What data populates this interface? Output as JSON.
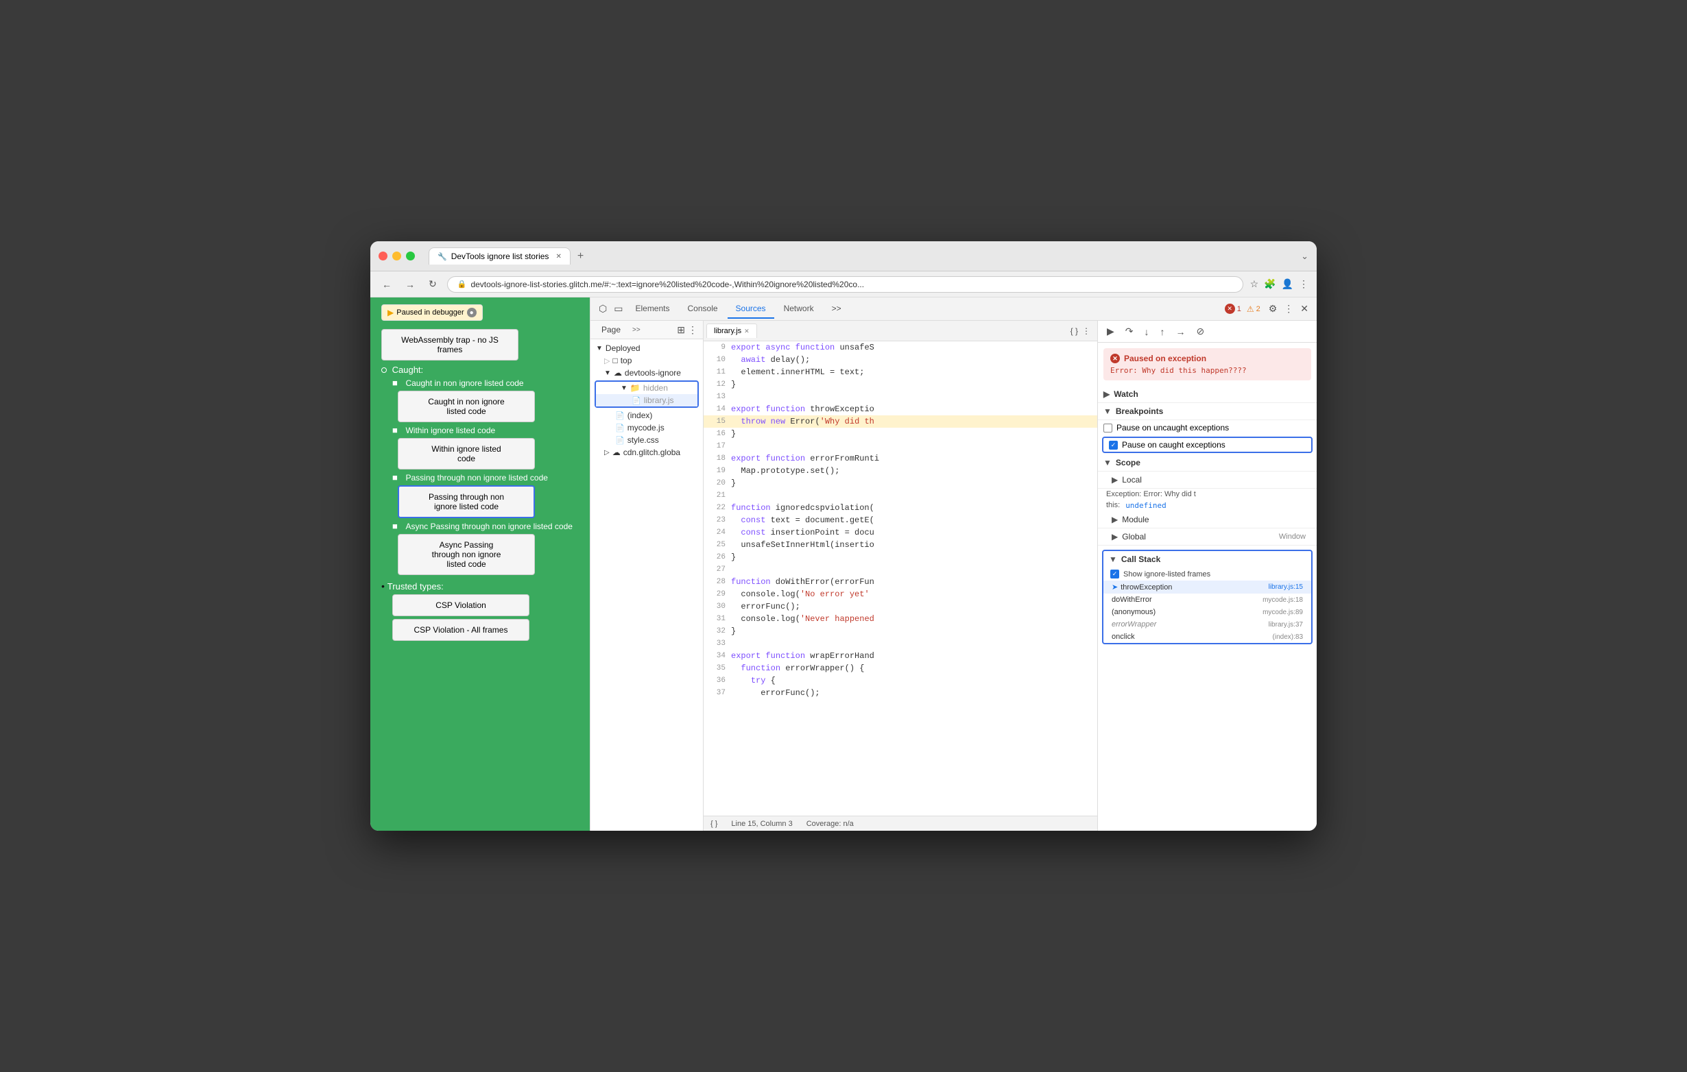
{
  "window": {
    "title": "DevTools ignore list stories",
    "url": "devtools-ignore-list-stories.glitch.me/#:~:text=ignore%20listed%20code-,Within%20ignore%20listed%20co..."
  },
  "browser": {
    "back_disabled": false,
    "forward_disabled": true
  },
  "page": {
    "paused_label": "Paused in debugger",
    "webassembly_label": "WebAssembly trap - no JS frames",
    "caught_title": "Caught:",
    "trusted_title": "Trusted types:",
    "caught_items": [
      {
        "label": "Caught in non ignore listed code",
        "btn_label": "Caught in non ignore\nlisted code",
        "highlighted": false
      },
      {
        "label": "Within ignore listed code",
        "btn_label": "Within ignore listed\ncode",
        "highlighted": false
      },
      {
        "label": "Passing through non ignore listed code",
        "btn_label": "Passing through non\nignore listed code",
        "highlighted": true
      },
      {
        "label": "Async Passing through non ignore listed code",
        "btn_label": "Async Passing\nthrough non ignore\nlisted code",
        "highlighted": false
      }
    ],
    "trusted_items": [
      "CSP Violation",
      "CSP Violation - All frames"
    ]
  },
  "devtools": {
    "tabs": [
      "Elements",
      "Console",
      "Sources",
      "Network",
      ">>"
    ],
    "active_tab": "Sources",
    "error_count": 1,
    "warning_count": 2
  },
  "sources": {
    "title": "Sources",
    "page_tab": "Page",
    "more_btn": ">>",
    "tree": [
      {
        "label": "Deployed",
        "level": 0,
        "type": "folder-open"
      },
      {
        "label": "top",
        "level": 1,
        "type": "folder"
      },
      {
        "label": "devtools-ignore",
        "level": 1,
        "type": "cloud",
        "expanded": true
      },
      {
        "label": "hidden",
        "level": 2,
        "type": "folder",
        "highlighted": true
      },
      {
        "label": "library.js",
        "level": 3,
        "type": "file-red",
        "highlighted": true,
        "selected": true
      },
      {
        "label": "(index)",
        "level": 2,
        "type": "file-gray"
      },
      {
        "label": "mycode.js",
        "level": 2,
        "type": "file-red"
      },
      {
        "label": "style.css",
        "level": 2,
        "type": "file-red"
      },
      {
        "label": "cdn.glitch.globa",
        "level": 1,
        "type": "cloud"
      }
    ]
  },
  "editor": {
    "filename": "library.js",
    "lines": [
      {
        "num": 9,
        "text": "export async function unsafeS",
        "highlight": false
      },
      {
        "num": 10,
        "text": "  await delay();",
        "highlight": false
      },
      {
        "num": 11,
        "text": "  element.innerHTML = text;",
        "highlight": false
      },
      {
        "num": 12,
        "text": "}",
        "highlight": false
      },
      {
        "num": 13,
        "text": "",
        "highlight": false
      },
      {
        "num": 14,
        "text": "export function throwExceptio",
        "highlight": false
      },
      {
        "num": 15,
        "text": "  throw new Error('Why did th",
        "highlight": true
      },
      {
        "num": 16,
        "text": "}",
        "highlight": false
      },
      {
        "num": 17,
        "text": "",
        "highlight": false
      },
      {
        "num": 18,
        "text": "export function errorFromRunti",
        "highlight": false
      },
      {
        "num": 19,
        "text": "  Map.prototype.set();",
        "highlight": false
      },
      {
        "num": 20,
        "text": "}",
        "highlight": false
      },
      {
        "num": 21,
        "text": "",
        "highlight": false
      },
      {
        "num": 22,
        "text": "function ignoredcspviolation(",
        "highlight": false
      },
      {
        "num": 23,
        "text": "  const text = document.getE(",
        "highlight": false
      },
      {
        "num": 24,
        "text": "  const insertionPoint = docu",
        "highlight": false
      },
      {
        "num": 25,
        "text": "  unsafeSetInnerHtml(insertio",
        "highlight": false
      },
      {
        "num": 26,
        "text": "}",
        "highlight": false
      },
      {
        "num": 27,
        "text": "",
        "highlight": false
      },
      {
        "num": 28,
        "text": "function doWithError(errorFun",
        "highlight": false
      },
      {
        "num": 29,
        "text": "  console.log('No error yet'",
        "highlight": false
      },
      {
        "num": 30,
        "text": "  errorFunc();",
        "highlight": false
      },
      {
        "num": 31,
        "text": "  console.log('Never happened",
        "highlight": false
      },
      {
        "num": 32,
        "text": "}",
        "highlight": false
      },
      {
        "num": 33,
        "text": "",
        "highlight": false
      },
      {
        "num": 34,
        "text": "export function wrapErrorHand",
        "highlight": false
      },
      {
        "num": 35,
        "text": "  function errorWrapper() {",
        "highlight": false
      },
      {
        "num": 36,
        "text": "    try {",
        "highlight": false
      },
      {
        "num": 37,
        "text": "      errorFunc();",
        "highlight": false
      }
    ],
    "status_line": "Line 15, Column 3",
    "status_coverage": "Coverage: n/a"
  },
  "debugger": {
    "exception": {
      "title": "Paused on exception",
      "message": "Error: Why did this happen????"
    },
    "sections": {
      "watch": "Watch",
      "breakpoints": "Breakpoints",
      "scope": "Scope",
      "call_stack": "Call Stack"
    },
    "breakpoints": {
      "uncaught_label": "Pause on uncaught exceptions",
      "uncaught_checked": false,
      "caught_label": "Pause on caught exceptions",
      "caught_checked": true
    },
    "scope": {
      "local": "Local",
      "exception_label": "Exception: Error: Why did t",
      "this_label": "this:",
      "this_value": "undefined",
      "module": "Module",
      "global": "Global",
      "global_value": "Window"
    },
    "call_stack": {
      "show_frames_label": "Show ignore-listed frames",
      "show_frames_checked": true,
      "frames": [
        {
          "fn": "throwException",
          "loc": "library.js:15",
          "active": true,
          "dimmed": false,
          "loc_blue": true
        },
        {
          "fn": "doWithError",
          "loc": "mycode.js:18",
          "active": false,
          "dimmed": false,
          "loc_blue": false
        },
        {
          "fn": "(anonymous)",
          "loc": "mycode.js:89",
          "active": false,
          "dimmed": false,
          "loc_blue": false
        },
        {
          "fn": "errorWrapper",
          "loc": "library.js:37",
          "active": false,
          "dimmed": true,
          "loc_blue": false
        },
        {
          "fn": "onclick",
          "loc": "(index):83",
          "active": false,
          "dimmed": false,
          "loc_blue": false
        }
      ]
    }
  }
}
